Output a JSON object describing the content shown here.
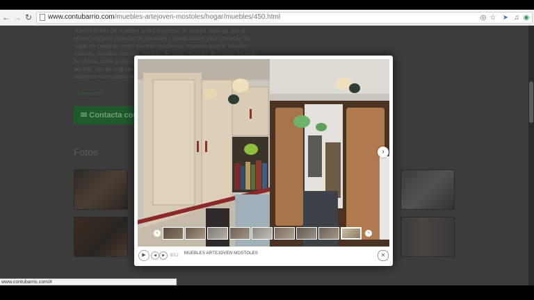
{
  "browser": {
    "url_host": "www.contubarrio.com",
    "url_path": "/muebles-artejoven-mostoles/hogar/muebles/450.html",
    "status_url": "www.contubarrio.com/#"
  },
  "background_page": {
    "description_text": "nuestra tienda de muebles podrá encontrar un amplio catálogo que le ofrece una gran variedad de opciones y posibilidades para amueblar su hogar en cualquier estilo muebles modernos, muebles juvenil, muebles clásicos, muebles rústicos, muebles de baño, muebles de cocina, muebles de oficina, sofás y sillones a medida para salón, dormitorios para niños y adultos, con las mejores calidades y precios por lo que no dude en visitarnos en muebles artejoven, estaremos encantados de atenderle",
    "more_link": "+ Información",
    "contact_button": "Contacta con",
    "fotos_heading": "Fotos"
  },
  "lightbox": {
    "counter": "8/12",
    "caption": "MUEBLES ARTEJOVEN MOSTOLES",
    "strip_prev_icon": "‹",
    "strip_next_icon": "›",
    "next_icon": "›",
    "close_icon": "✕",
    "play_icon": "▶",
    "prev_icon": "◀",
    "fwd_icon": "▶"
  },
  "colors": {
    "overlay": "#3c3c3c",
    "contact_green": "#1f5a2b"
  }
}
